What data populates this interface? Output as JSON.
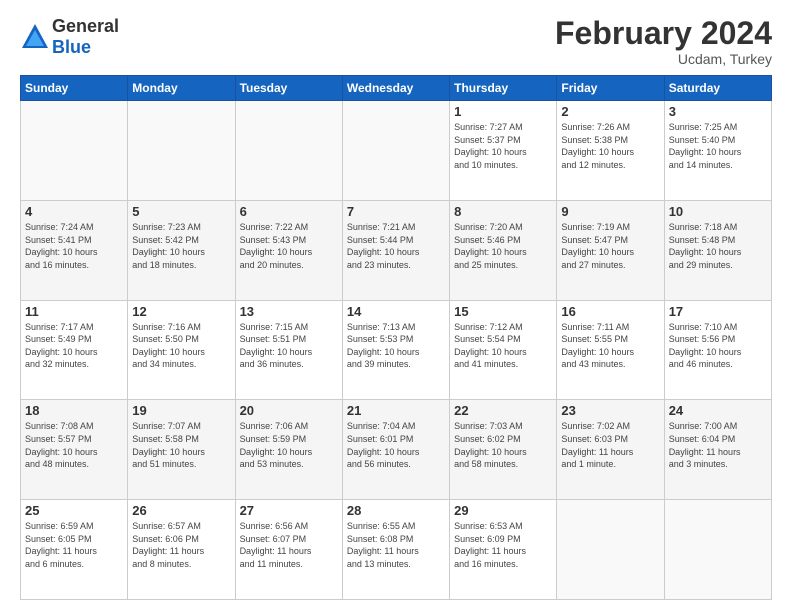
{
  "header": {
    "logo_general": "General",
    "logo_blue": "Blue",
    "month_title": "February 2024",
    "location": "Ucdam, Turkey"
  },
  "calendar": {
    "days_of_week": [
      "Sunday",
      "Monday",
      "Tuesday",
      "Wednesday",
      "Thursday",
      "Friday",
      "Saturday"
    ],
    "weeks": [
      [
        {
          "day": "",
          "info": ""
        },
        {
          "day": "",
          "info": ""
        },
        {
          "day": "",
          "info": ""
        },
        {
          "day": "",
          "info": ""
        },
        {
          "day": "1",
          "info": "Sunrise: 7:27 AM\nSunset: 5:37 PM\nDaylight: 10 hours\nand 10 minutes."
        },
        {
          "day": "2",
          "info": "Sunrise: 7:26 AM\nSunset: 5:38 PM\nDaylight: 10 hours\nand 12 minutes."
        },
        {
          "day": "3",
          "info": "Sunrise: 7:25 AM\nSunset: 5:40 PM\nDaylight: 10 hours\nand 14 minutes."
        }
      ],
      [
        {
          "day": "4",
          "info": "Sunrise: 7:24 AM\nSunset: 5:41 PM\nDaylight: 10 hours\nand 16 minutes."
        },
        {
          "day": "5",
          "info": "Sunrise: 7:23 AM\nSunset: 5:42 PM\nDaylight: 10 hours\nand 18 minutes."
        },
        {
          "day": "6",
          "info": "Sunrise: 7:22 AM\nSunset: 5:43 PM\nDaylight: 10 hours\nand 20 minutes."
        },
        {
          "day": "7",
          "info": "Sunrise: 7:21 AM\nSunset: 5:44 PM\nDaylight: 10 hours\nand 23 minutes."
        },
        {
          "day": "8",
          "info": "Sunrise: 7:20 AM\nSunset: 5:46 PM\nDaylight: 10 hours\nand 25 minutes."
        },
        {
          "day": "9",
          "info": "Sunrise: 7:19 AM\nSunset: 5:47 PM\nDaylight: 10 hours\nand 27 minutes."
        },
        {
          "day": "10",
          "info": "Sunrise: 7:18 AM\nSunset: 5:48 PM\nDaylight: 10 hours\nand 29 minutes."
        }
      ],
      [
        {
          "day": "11",
          "info": "Sunrise: 7:17 AM\nSunset: 5:49 PM\nDaylight: 10 hours\nand 32 minutes."
        },
        {
          "day": "12",
          "info": "Sunrise: 7:16 AM\nSunset: 5:50 PM\nDaylight: 10 hours\nand 34 minutes."
        },
        {
          "day": "13",
          "info": "Sunrise: 7:15 AM\nSunset: 5:51 PM\nDaylight: 10 hours\nand 36 minutes."
        },
        {
          "day": "14",
          "info": "Sunrise: 7:13 AM\nSunset: 5:53 PM\nDaylight: 10 hours\nand 39 minutes."
        },
        {
          "day": "15",
          "info": "Sunrise: 7:12 AM\nSunset: 5:54 PM\nDaylight: 10 hours\nand 41 minutes."
        },
        {
          "day": "16",
          "info": "Sunrise: 7:11 AM\nSunset: 5:55 PM\nDaylight: 10 hours\nand 43 minutes."
        },
        {
          "day": "17",
          "info": "Sunrise: 7:10 AM\nSunset: 5:56 PM\nDaylight: 10 hours\nand 46 minutes."
        }
      ],
      [
        {
          "day": "18",
          "info": "Sunrise: 7:08 AM\nSunset: 5:57 PM\nDaylight: 10 hours\nand 48 minutes."
        },
        {
          "day": "19",
          "info": "Sunrise: 7:07 AM\nSunset: 5:58 PM\nDaylight: 10 hours\nand 51 minutes."
        },
        {
          "day": "20",
          "info": "Sunrise: 7:06 AM\nSunset: 5:59 PM\nDaylight: 10 hours\nand 53 minutes."
        },
        {
          "day": "21",
          "info": "Sunrise: 7:04 AM\nSunset: 6:01 PM\nDaylight: 10 hours\nand 56 minutes."
        },
        {
          "day": "22",
          "info": "Sunrise: 7:03 AM\nSunset: 6:02 PM\nDaylight: 10 hours\nand 58 minutes."
        },
        {
          "day": "23",
          "info": "Sunrise: 7:02 AM\nSunset: 6:03 PM\nDaylight: 11 hours\nand 1 minute."
        },
        {
          "day": "24",
          "info": "Sunrise: 7:00 AM\nSunset: 6:04 PM\nDaylight: 11 hours\nand 3 minutes."
        }
      ],
      [
        {
          "day": "25",
          "info": "Sunrise: 6:59 AM\nSunset: 6:05 PM\nDaylight: 11 hours\nand 6 minutes."
        },
        {
          "day": "26",
          "info": "Sunrise: 6:57 AM\nSunset: 6:06 PM\nDaylight: 11 hours\nand 8 minutes."
        },
        {
          "day": "27",
          "info": "Sunrise: 6:56 AM\nSunset: 6:07 PM\nDaylight: 11 hours\nand 11 minutes."
        },
        {
          "day": "28",
          "info": "Sunrise: 6:55 AM\nSunset: 6:08 PM\nDaylight: 11 hours\nand 13 minutes."
        },
        {
          "day": "29",
          "info": "Sunrise: 6:53 AM\nSunset: 6:09 PM\nDaylight: 11 hours\nand 16 minutes."
        },
        {
          "day": "",
          "info": ""
        },
        {
          "day": "",
          "info": ""
        }
      ]
    ]
  }
}
